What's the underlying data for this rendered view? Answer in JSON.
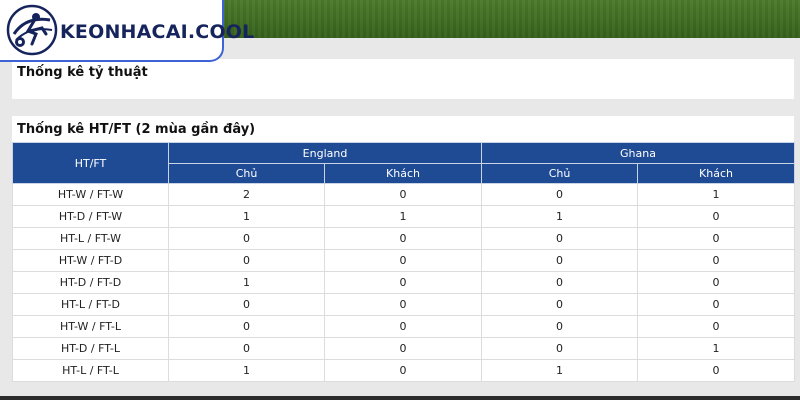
{
  "logo": {
    "text": "KEONHACAI.COOL"
  },
  "stats_panel": {
    "title": "Thống kê tỷ thuật"
  },
  "htft_panel": {
    "title": "Thống kê HT/FT (2 mùa gần đây)",
    "col_htft": "HT/FT",
    "teams": [
      "England",
      "Ghana"
    ],
    "sub_cols": [
      "Chủ",
      "Khách",
      "Chủ",
      "Khách"
    ],
    "rows": [
      {
        "label": "HT-W / FT-W",
        "values": [
          "2",
          "0",
          "0",
          "1"
        ]
      },
      {
        "label": "HT-D / FT-W",
        "values": [
          "1",
          "1",
          "1",
          "0"
        ]
      },
      {
        "label": "HT-L / FT-W",
        "values": [
          "0",
          "0",
          "0",
          "0"
        ]
      },
      {
        "label": "HT-W / FT-D",
        "values": [
          "0",
          "0",
          "0",
          "0"
        ]
      },
      {
        "label": "HT-D / FT-D",
        "values": [
          "1",
          "0",
          "0",
          "0"
        ]
      },
      {
        "label": "HT-L / FT-D",
        "values": [
          "0",
          "0",
          "0",
          "0"
        ]
      },
      {
        "label": "HT-W / FT-L",
        "values": [
          "0",
          "0",
          "0",
          "0"
        ]
      },
      {
        "label": "HT-D / FT-L",
        "values": [
          "0",
          "0",
          "0",
          "1"
        ]
      },
      {
        "label": "HT-L / FT-L",
        "values": [
          "1",
          "0",
          "1",
          "0"
        ]
      }
    ]
  },
  "colors": {
    "header_bg": "#1f4b94",
    "logo_border": "#3d63d4",
    "logo_text": "#16245c"
  }
}
